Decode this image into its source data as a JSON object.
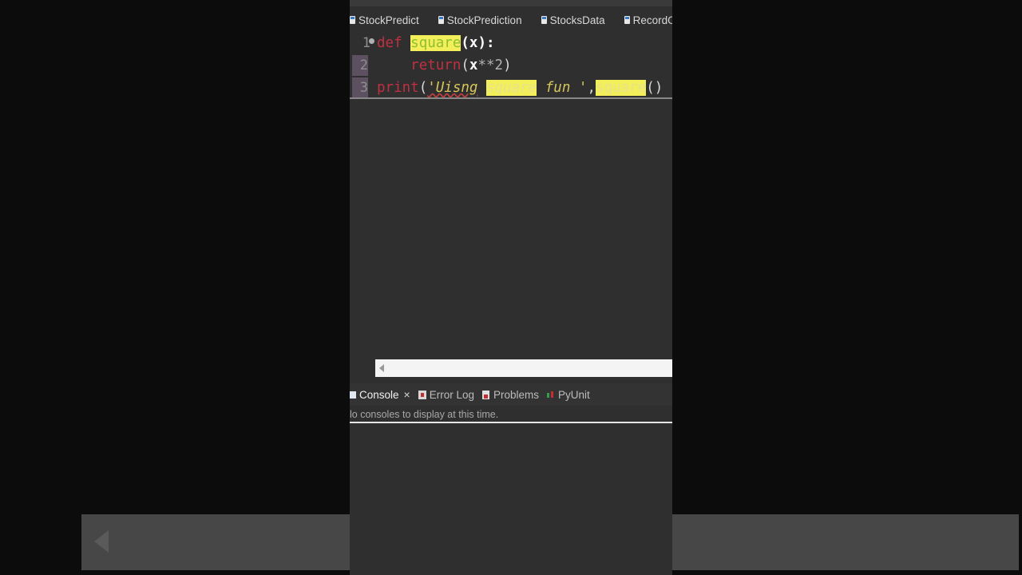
{
  "editor_tabs": [
    {
      "label": "StockPredict"
    },
    {
      "label": "StockPrediction"
    },
    {
      "label": "StocksData"
    },
    {
      "label": "RecordOwnVoi"
    }
  ],
  "code": {
    "line_numbers": [
      "1",
      "2",
      "3"
    ],
    "line1": {
      "kw": "def",
      "fn": "square",
      "params": "(x)",
      "colon": ":"
    },
    "line2": {
      "kw": "return",
      "open": "(",
      "var": "x",
      "op": "**",
      "num": "2",
      "close": ")"
    },
    "line3": {
      "kw": "print",
      "open": "(",
      "str_a": "'Uisng",
      "str_b": "square",
      "str_c": "fun '",
      "comma": ",",
      "call": "square",
      "args": "()"
    }
  },
  "console_panel": {
    "tabs": [
      {
        "label": "Console",
        "active": true
      },
      {
        "label": "Error Log"
      },
      {
        "label": "Problems"
      },
      {
        "label": "PyUnit"
      }
    ],
    "close_glyph": "×",
    "message": "lo consoles to display at this time."
  },
  "colors": {
    "keyword": "#c13040",
    "highlight": "#f3ef5a",
    "string": "#d8c55a",
    "editor_bg": "#2f2f2f"
  }
}
